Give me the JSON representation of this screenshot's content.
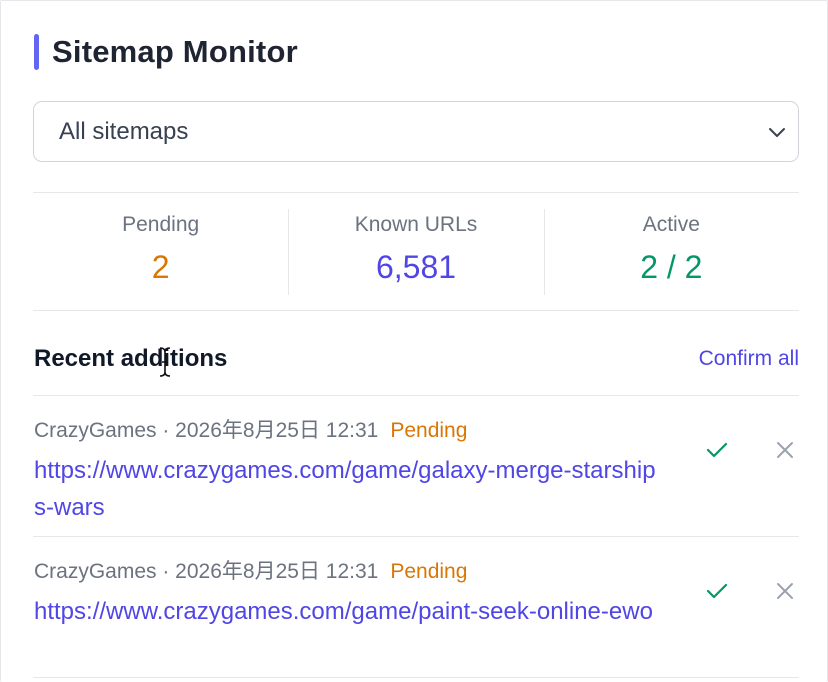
{
  "header": {
    "title": "Sitemap Monitor"
  },
  "filter": {
    "selected": "All sitemaps"
  },
  "stats": [
    {
      "label": "Pending",
      "value": "2",
      "color": "#d97706"
    },
    {
      "label": "Known URLs",
      "value": "6,581",
      "color": "#4f46e5"
    },
    {
      "label": "Active",
      "value": "2 / 2",
      "color": "#059669"
    }
  ],
  "recent": {
    "title": "Recent additions",
    "confirm_all": "Confirm all",
    "items": [
      {
        "source": "CrazyGames · 2026年8月25日 12:31",
        "status": "Pending",
        "url": "https://www.crazygames.com/game/galaxy-merge-starships-wars"
      },
      {
        "source": "CrazyGames · 2026年8月25日 12:31",
        "status": "Pending",
        "url": "https://www.crazygames.com/game/paint-seek-online-ewo"
      }
    ]
  },
  "icons": {
    "accent": "#6366f1",
    "confirm_color": "#059669",
    "dismiss_color": "#9ca3af"
  }
}
